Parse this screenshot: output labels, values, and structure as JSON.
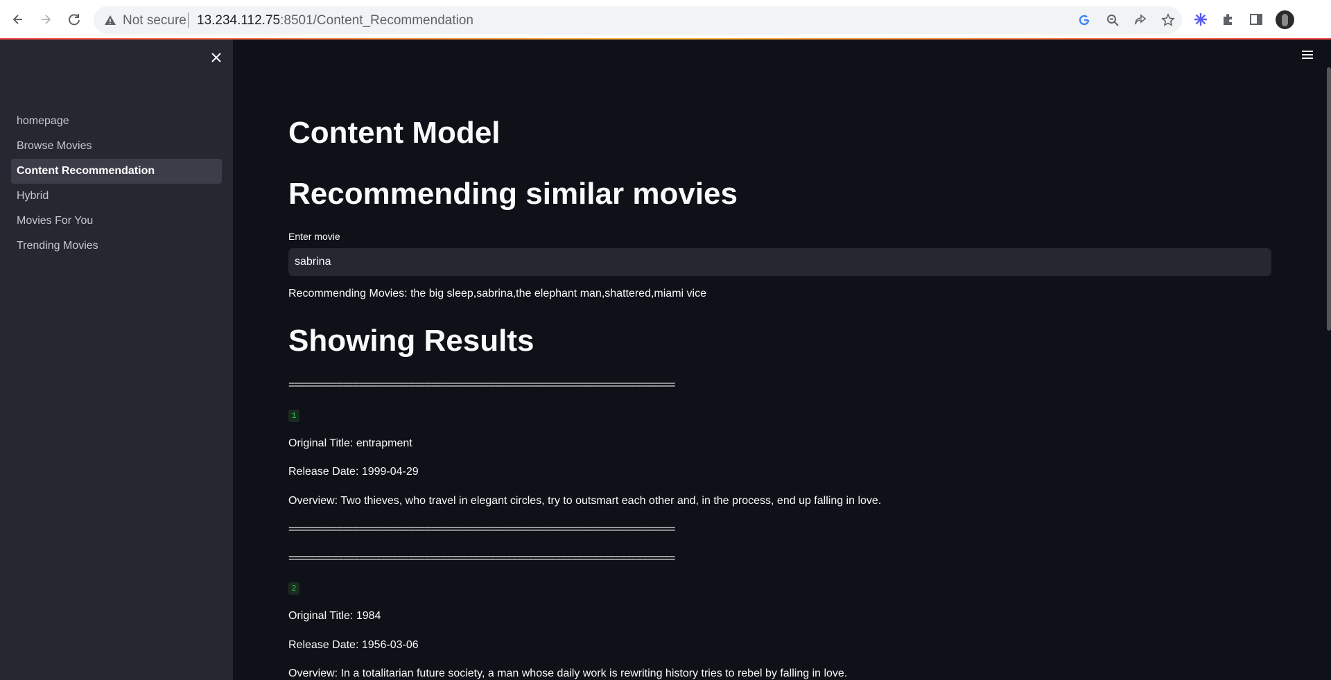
{
  "browser": {
    "security_text": "Not secure",
    "url_host": "13.234.112.75",
    "url_rest": ":8501/Content_Recommendation"
  },
  "sidebar": {
    "items": [
      {
        "label": "homepage",
        "active": false
      },
      {
        "label": "Browse Movies",
        "active": false
      },
      {
        "label": "Content Recommendation",
        "active": true
      },
      {
        "label": "Hybrid",
        "active": false
      },
      {
        "label": "Movies For You",
        "active": false
      },
      {
        "label": "Trending Movies",
        "active": false
      }
    ]
  },
  "main": {
    "title": "Content Model",
    "subtitle": "Recommending similar movies",
    "input_label": "Enter movie",
    "input_value": "sabrina",
    "recommending_text": "Recommending Movies: the big sleep,sabrina,the elephant man,shattered,miami vice",
    "results_heading": "Showing Results",
    "separator": "=======================================================================",
    "results": [
      {
        "index": "1",
        "original_title": "Original Title: entrapment",
        "release_date": "Release Date: 1999-04-29",
        "overview": "Overview: Two thieves, who travel in elegant circles, try to outsmart each other and, in the process, end up falling in love."
      },
      {
        "index": "2",
        "original_title": "Original Title: 1984",
        "release_date": "Release Date: 1956-03-06",
        "overview": "Overview: In a totalitarian future society, a man whose daily work is rewriting history tries to rebel by falling in love."
      }
    ]
  },
  "colors": {
    "app_background": "#0e1117",
    "sidebar_background": "#262730",
    "badge_text": "#21c354"
  }
}
